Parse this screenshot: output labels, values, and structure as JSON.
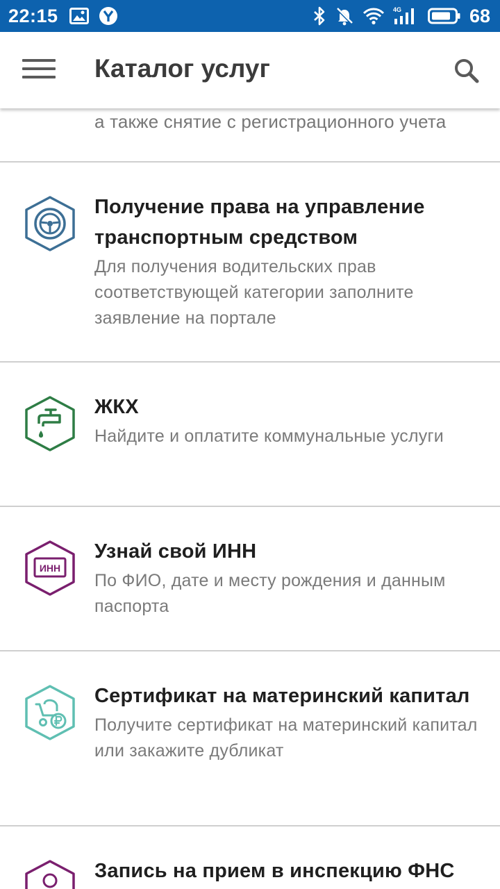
{
  "status_bar": {
    "time": "22:15",
    "battery_level": "68",
    "network_label": "4G",
    "icons": [
      "gallery-icon",
      "yandex-icon",
      "bluetooth-icon",
      "notifications-off-icon",
      "wifi-icon",
      "signal-4g-icon",
      "battery-icon"
    ],
    "background_color": "#0d62ae"
  },
  "app_bar": {
    "title": "Каталог услуг",
    "menu_icon": "hamburger-menu-icon",
    "search_icon": "search-icon"
  },
  "catalog": {
    "partial_item_desc": "а также снятие с регистрационного учета",
    "items": [
      {
        "title": "Получение права на управление транспортным средством",
        "description": "Для получения водительских прав соответствующей категории заполните заявление на портале",
        "icon": "steering-wheel-icon",
        "color": "#3d6f95"
      },
      {
        "title": "ЖКХ",
        "description": "Найдите и оплатите коммунальные услуги",
        "icon": "water-tap-icon",
        "color": "#2e7d45"
      },
      {
        "title": "Узнай свой ИНН",
        "description": "По ФИО, дате и месту рождения и данным паспорта",
        "icon": "inn-card-icon",
        "icon_text": "ИНН",
        "color": "#7a1f6e"
      },
      {
        "title": "Сертификат на материнский капитал",
        "description": "Получите сертификат на материнский капитал или закажите дубликат",
        "icon": "stroller-ruble-icon",
        "color": "#5fbfb2"
      },
      {
        "title": "Запись на прием в инспекцию ФНС",
        "description": "",
        "icon": "person-icon",
        "color": "#7a1f6e"
      }
    ]
  }
}
